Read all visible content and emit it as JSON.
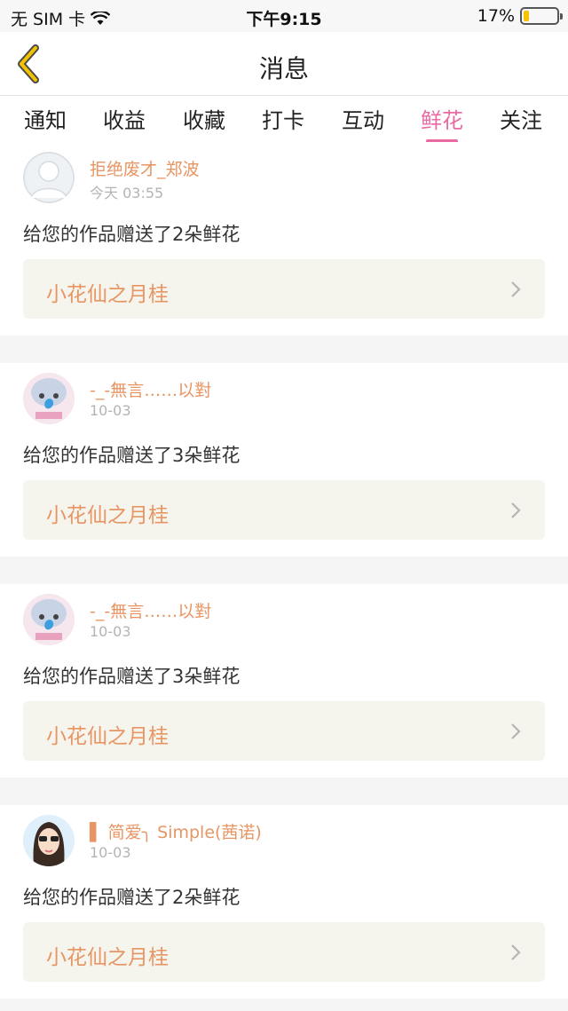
{
  "status_bar": {
    "carrier": "无 SIM 卡",
    "time": "下午9:15",
    "battery": "17%",
    "battery_level": 0.17
  },
  "nav": {
    "title": "消息"
  },
  "tabs": [
    {
      "label": "通知",
      "active": false
    },
    {
      "label": "收益",
      "active": false
    },
    {
      "label": "收藏",
      "active": false
    },
    {
      "label": "打卡",
      "active": false
    },
    {
      "label": "互动",
      "active": false
    },
    {
      "label": "鲜花",
      "active": true
    },
    {
      "label": "关注",
      "active": false
    }
  ],
  "messages": [
    {
      "username": "拒绝废才_郑波",
      "time": "今天 03:55",
      "text": "给您的作品赠送了2朵鲜花",
      "work": "小花仙之月桂",
      "avatar": "default-avatar-icon"
    },
    {
      "username": "-_-無言……以對",
      "time": "10-03",
      "text": "给您的作品赠送了3朵鲜花",
      "work": "小花仙之月桂",
      "avatar": "user-photo-avatar"
    },
    {
      "username": "-_-無言……以對",
      "time": "10-03",
      "text": "给您的作品赠送了3朵鲜花",
      "work": "小花仙之月桂",
      "avatar": "user-photo-avatar"
    },
    {
      "username": "▌ 简爱╮ Simple(茜诺)",
      "time": "10-03",
      "text": "给您的作品赠送了2朵鲜花",
      "work": "小花仙之月桂",
      "avatar": "user-photo-avatar"
    }
  ],
  "colors": {
    "accent": "#e96aa3",
    "username": "#e89564",
    "back_arrow": "#f2c200"
  }
}
